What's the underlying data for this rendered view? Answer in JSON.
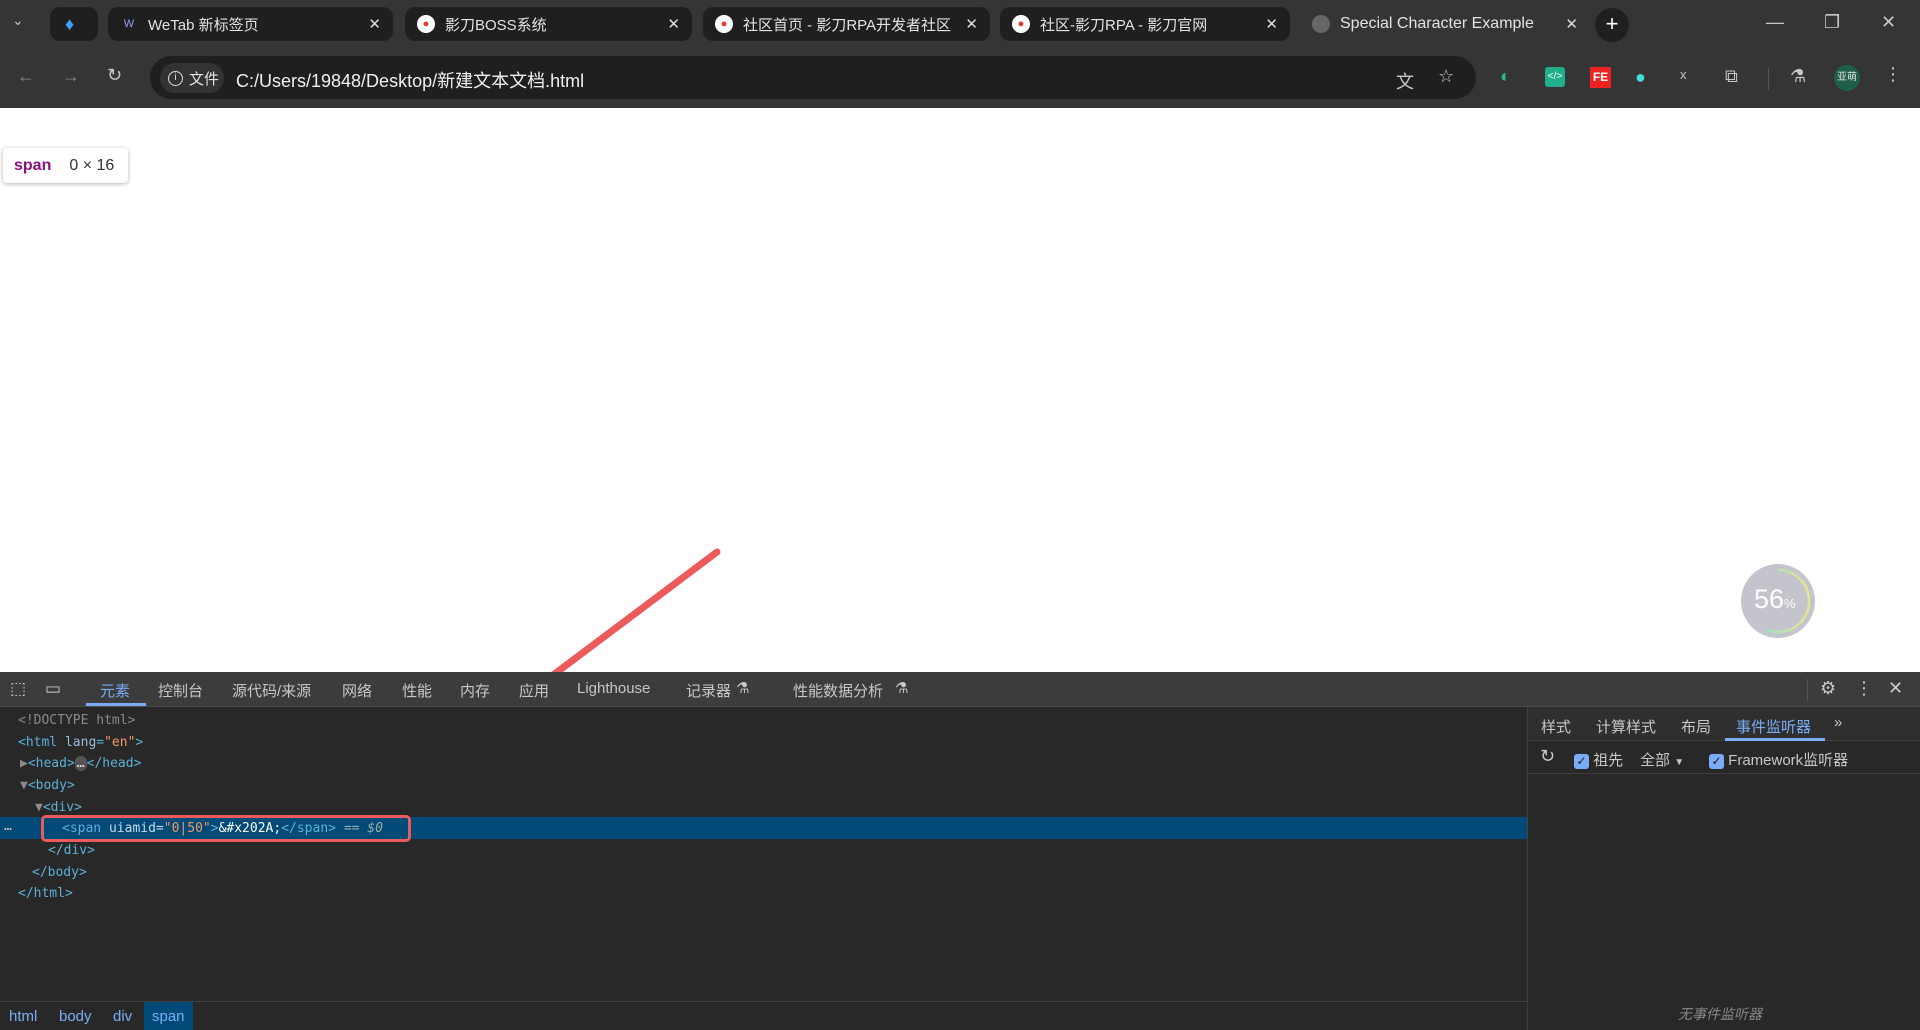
{
  "tabs": [
    {
      "label": "WeTab 新标签页"
    },
    {
      "label": "影刀BOSS系统"
    },
    {
      "label": "社区首页 - 影刀RPA开发者社区"
    },
    {
      "label": "社区-影刀RPA - 影刀官网"
    },
    {
      "label": "Special Character Example",
      "active": true
    }
  ],
  "toolbar": {
    "chip": "文件",
    "url": "C:/Users/19848/Desktop/新建文本文档.html",
    "avatar": "亚萌"
  },
  "inspector_tooltip": {
    "tag": "span",
    "size": "0 × 16"
  },
  "progress_widget": {
    "value": 56,
    "label": "56",
    "unit": "%"
  },
  "devtools": {
    "tabs": [
      "元素",
      "控制台",
      "源代码/来源",
      "网络",
      "性能",
      "内存",
      "应用",
      "Lighthouse",
      "记录器",
      "性能数据分析"
    ],
    "active_tab": "元素",
    "dom": {
      "doctype": "<!DOCTYPE html>",
      "html_open": "<html ",
      "lang_attr": "lang",
      "lang_val": "\"en\"",
      "head": "<head>",
      "head_close": "</head>",
      "body": "<body>",
      "div": "<div>",
      "span_open": "<span ",
      "uiamid_attr": "uiamid=",
      "uiamid_val": "\"0|50\"",
      "span_content": "&#x202A;",
      "span_close": "</span>",
      "selected_marker": "== $0",
      "div_close": "</div>",
      "body_close": "</body>",
      "html_close": "</html>"
    },
    "side_tabs": [
      "样式",
      "计算样式",
      "布局",
      "事件监听器"
    ],
    "side_active": "事件监听器",
    "ancestors_label": "祖先",
    "filter_value": "全部",
    "framework_label": "Framework监听器",
    "empty_text": "无事件监听器",
    "breadcrumbs": [
      "html",
      "body",
      "div",
      "span"
    ]
  },
  "colors": {
    "accent": "#7cacf8",
    "selection": "#004a77",
    "annotation": "#ec5a5a"
  }
}
